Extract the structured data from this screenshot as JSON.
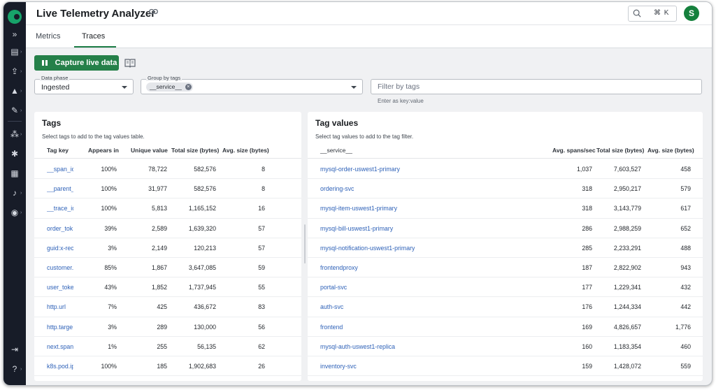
{
  "app": {
    "title": "Live Telemetry Analyzer",
    "user_initial": "S"
  },
  "search": {
    "shortcut": "⌘ K"
  },
  "tabs": [
    {
      "label": "Metrics"
    },
    {
      "label": "Traces"
    }
  ],
  "toolbar": {
    "capture_label": "Capture live data"
  },
  "filters": {
    "data_phase": {
      "label": "Data phase",
      "value": "Ingested"
    },
    "group_by": {
      "label": "Group by tags",
      "chip": "__service__"
    },
    "filter_tags": {
      "placeholder": "Filter by tags",
      "hint": "Enter as key:value"
    }
  },
  "tags_panel": {
    "title": "Tags",
    "subtitle": "Select tags to add to the tag values table.",
    "columns": [
      "Tag key",
      "Appears in",
      "Unique value",
      "Total size (bytes)",
      "Avg. size (bytes)"
    ],
    "rows": [
      {
        "key": "__span_id_",
        "appears": "100%",
        "unique": "78,722",
        "total": "582,576",
        "avg": "8"
      },
      {
        "key": "__parent_s",
        "appears": "100%",
        "unique": "31,977",
        "total": "582,576",
        "avg": "8"
      },
      {
        "key": "__trace_id",
        "appears": "100%",
        "unique": "5,813",
        "total": "1,165,152",
        "avg": "16"
      },
      {
        "key": "order_tok",
        "appears": "39%",
        "unique": "2,589",
        "total": "1,639,320",
        "avg": "57"
      },
      {
        "key": "guid:x-rec",
        "appears": "3%",
        "unique": "2,149",
        "total": "120,213",
        "avg": "57"
      },
      {
        "key": "customer.",
        "appears": "85%",
        "unique": "1,867",
        "total": "3,647,085",
        "avg": "59"
      },
      {
        "key": "user_toke",
        "appears": "43%",
        "unique": "1,852",
        "total": "1,737,945",
        "avg": "55"
      },
      {
        "key": "http.url",
        "appears": "7%",
        "unique": "425",
        "total": "436,672",
        "avg": "83"
      },
      {
        "key": "http.targe",
        "appears": "3%",
        "unique": "289",
        "total": "130,000",
        "avg": "56"
      },
      {
        "key": "next.span",
        "appears": "1%",
        "unique": "255",
        "total": "56,135",
        "avg": "62"
      },
      {
        "key": "k8s.pod.ip",
        "appears": "100%",
        "unique": "185",
        "total": "1,902,683",
        "avg": "26"
      }
    ]
  },
  "values_panel": {
    "title": "Tag values",
    "subtitle": "Select tag values to add to the tag filter.",
    "columns": [
      "__service__",
      "Avg. spans/sec",
      "Total size (bytes)",
      "Avg. size (bytes)"
    ],
    "rows": [
      {
        "name": "mysql-order-uswest1-primary",
        "spans": "1,037",
        "total": "7,603,527",
        "avg": "458"
      },
      {
        "name": "ordering-svc",
        "spans": "318",
        "total": "2,950,217",
        "avg": "579"
      },
      {
        "name": "mysql-item-uswest1-primary",
        "spans": "318",
        "total": "3,143,779",
        "avg": "617"
      },
      {
        "name": "mysql-bill-uswest1-primary",
        "spans": "286",
        "total": "2,988,259",
        "avg": "652"
      },
      {
        "name": "mysql-notification-uswest1-primary",
        "spans": "285",
        "total": "2,233,291",
        "avg": "488"
      },
      {
        "name": "frontendproxy",
        "spans": "187",
        "total": "2,822,902",
        "avg": "943"
      },
      {
        "name": "portal-svc",
        "spans": "177",
        "total": "1,229,341",
        "avg": "432"
      },
      {
        "name": "auth-svc",
        "spans": "176",
        "total": "1,244,334",
        "avg": "442"
      },
      {
        "name": "frontend",
        "spans": "169",
        "total": "4,826,657",
        "avg": "1,776"
      },
      {
        "name": "mysql-auth-uswest1-replica",
        "spans": "160",
        "total": "1,183,354",
        "avg": "460"
      },
      {
        "name": "inventory-svc",
        "spans": "159",
        "total": "1,428,072",
        "avg": "559"
      }
    ]
  },
  "sidebar_icons": [
    "expand-icon",
    "document-icon",
    "deploy-icon",
    "shapes-icon",
    "wrench-icon",
    "infrastructure-icon",
    "network-icon",
    "dashboard-icon",
    "bell-icon",
    "compass-icon",
    "logout-icon",
    "help-icon"
  ]
}
